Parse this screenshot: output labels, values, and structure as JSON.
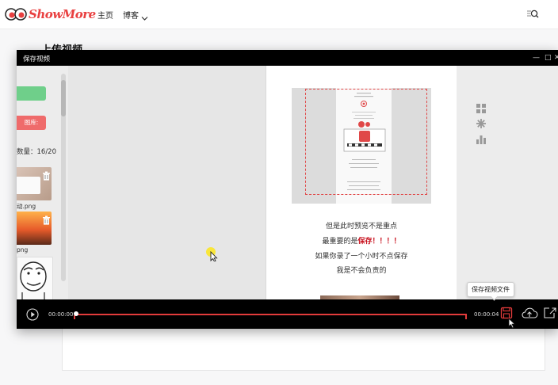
{
  "site": {
    "logo_text": "ShowMore",
    "nav": {
      "home": "主页",
      "blog": "博客"
    },
    "page_heading": "上传视频"
  },
  "modal": {
    "title": "保存视频",
    "controls": {
      "minimize": "—",
      "maximize": "□",
      "close": "✕"
    }
  },
  "library": {
    "red_button": "图库:",
    "count": "数量：16/20",
    "items": [
      {
        "label": "动.png"
      },
      {
        "label": "png"
      }
    ]
  },
  "canvas": {
    "copy_lines": [
      {
        "text": "但是此时预览不是重点",
        "emph": ""
      },
      {
        "text": "最重要的是",
        "emph": "保存！！！！"
      },
      {
        "text": "如果你录了一个小时不点保存",
        "emph": ""
      },
      {
        "text": "我是不会负责的",
        "emph": ""
      }
    ],
    "tools": [
      "grid-icon",
      "sparkle-icon",
      "bar-chart-icon"
    ]
  },
  "player": {
    "current_time": "00:00:00",
    "total_time": "00:00:04",
    "progress": 0,
    "tooltip": "保存视频文件"
  },
  "colors": {
    "accent": "#e23b3b",
    "green": "#6fcf8a",
    "red": "#ef6b6b"
  }
}
